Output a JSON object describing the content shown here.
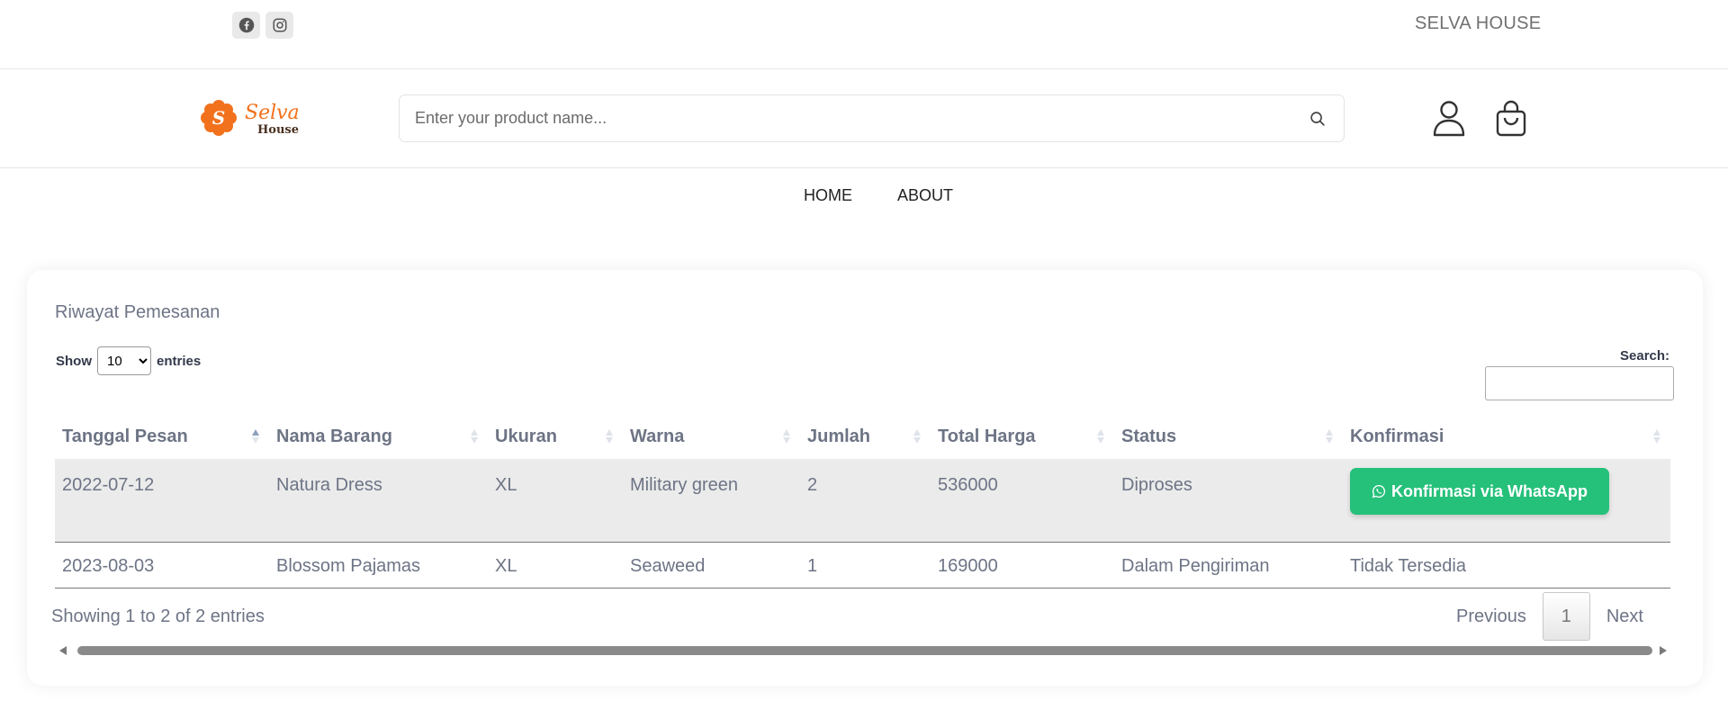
{
  "topbar": {
    "social": [
      {
        "icon": "facebook-icon"
      },
      {
        "icon": "instagram-icon"
      }
    ],
    "brand": "SELVA HOUSE"
  },
  "header": {
    "logo": {
      "main": "Selva",
      "sub": "House",
      "letter": "S",
      "color": "#f2711c"
    },
    "search": {
      "placeholder": "Enter your product name..."
    },
    "icons": [
      "user-icon",
      "shopping-bag-icon"
    ]
  },
  "nav": {
    "items": [
      {
        "label": "HOME"
      },
      {
        "label": "ABOUT"
      }
    ]
  },
  "card": {
    "title": "Riwayat Pemesanan",
    "length": {
      "prefix": "Show",
      "value": "10",
      "suffix": "entries"
    },
    "filter": {
      "label": "Search:"
    },
    "columns": [
      "Tanggal Pesan",
      "Nama Barang",
      "Ukuran",
      "Warna",
      "Jumlah",
      "Total Harga",
      "Status",
      "Konfirmasi"
    ],
    "rows": [
      {
        "tanggal": "2022-07-12",
        "nama": "Natura Dress",
        "ukuran": "XL",
        "warna": "Military green",
        "jumlah": "2",
        "total": "536000",
        "status": "Diproses",
        "konfirmasi": "Konfirmasi via WhatsApp"
      },
      {
        "tanggal": "2023-08-03",
        "nama": "Blossom Pajamas",
        "ukuran": "XL",
        "warna": "Seaweed",
        "jumlah": "1",
        "total": "169000",
        "status": "Dalam Pengiriman",
        "konfirmasi": "Tidak Tersedia"
      }
    ],
    "info": "Showing 1 to 2 of 2 entries",
    "pagination": {
      "previous": "Previous",
      "current": "1",
      "next": "Next"
    }
  },
  "colors": {
    "accent": "#25c07a",
    "brand": "#f2711c",
    "text": "#6d7485"
  }
}
